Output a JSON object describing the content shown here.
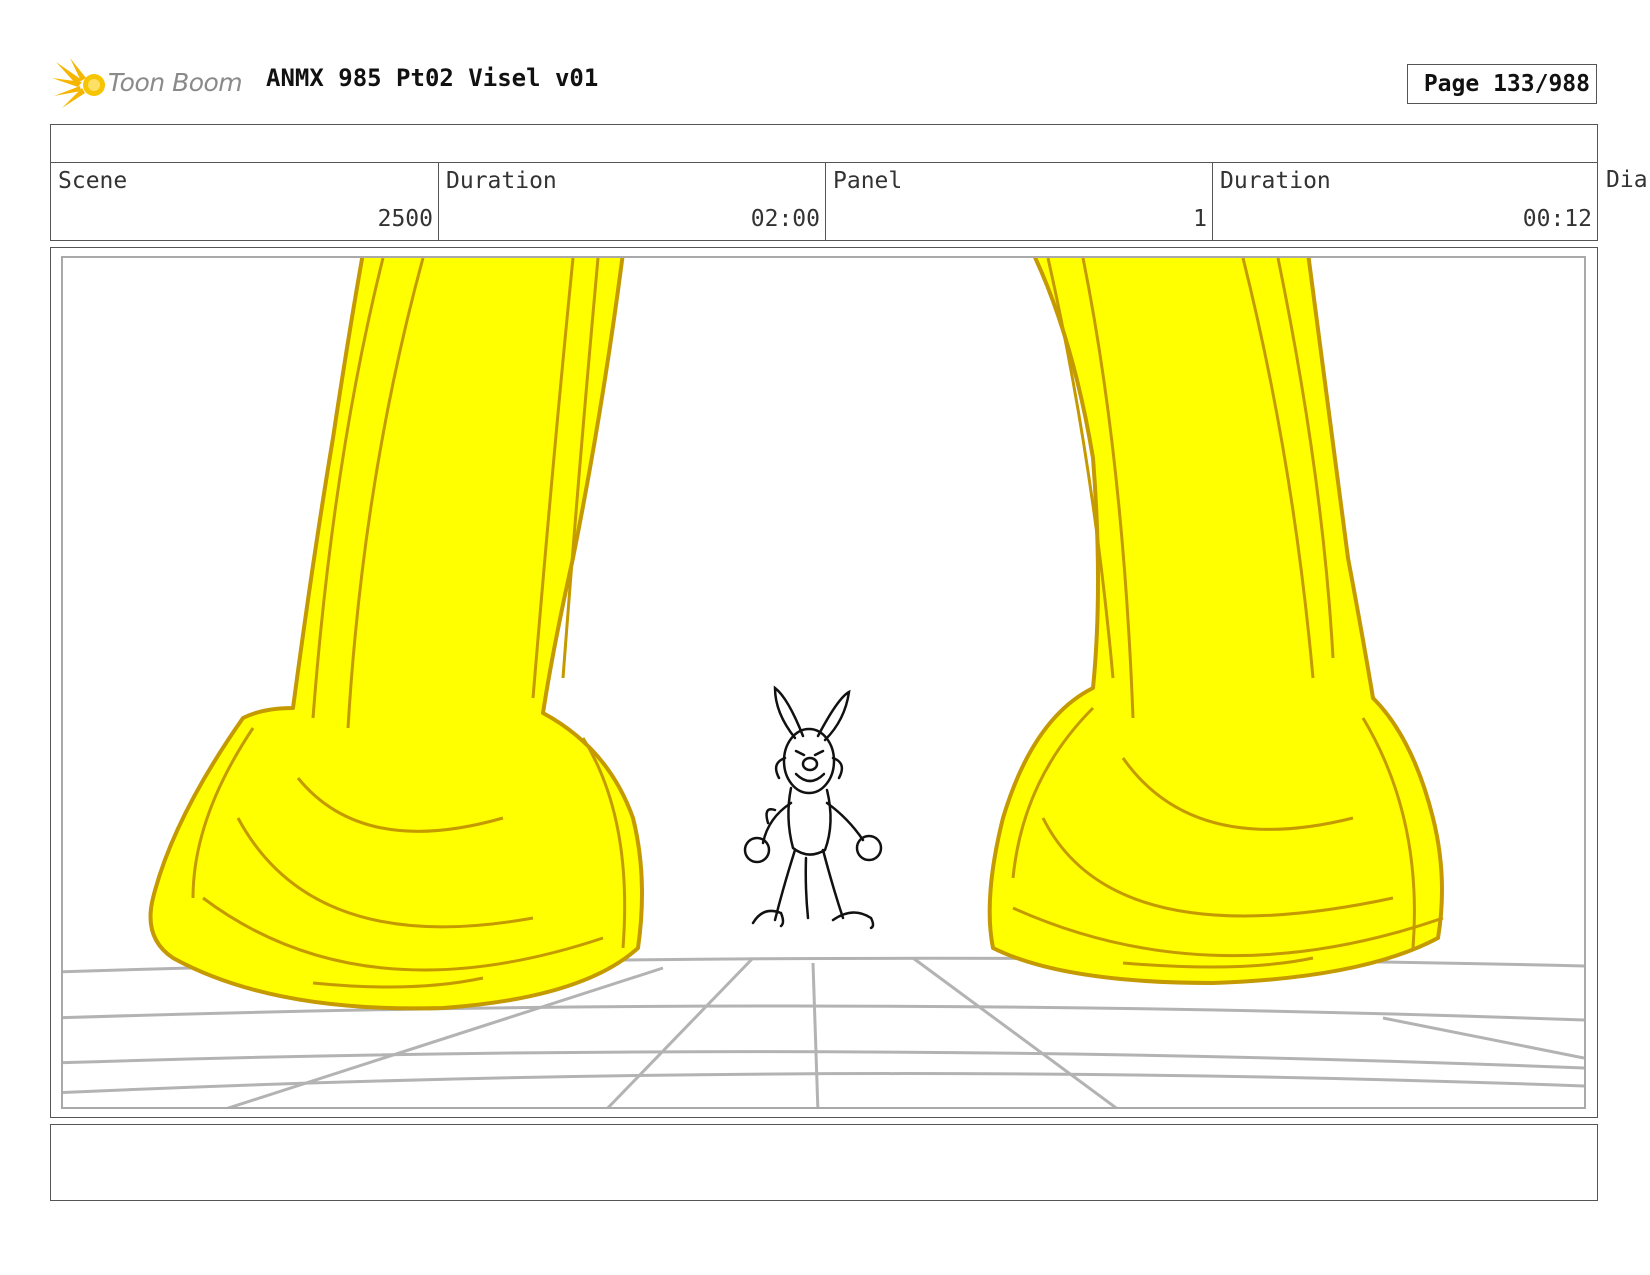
{
  "header": {
    "logo_text": "Toon Boom",
    "doc_title": "ANMX 985 Pt02 Visel v01",
    "page_label": "Page 133/988"
  },
  "info": {
    "scene_label": "Scene",
    "scene_value": "2500",
    "scene_duration_label": "Duration",
    "scene_duration_value": "02:00",
    "panel_label": "Panel",
    "panel_value": "1",
    "panel_duration_label": "Duration",
    "panel_duration_value": "00:12",
    "dialog_label_partial": "Dia"
  },
  "colors": {
    "leg_fill": "#ffff00",
    "leg_stroke": "#c49a00",
    "floor_lines": "#b3b3b3",
    "border": "#555555",
    "logo_orange": "#f5b500"
  },
  "icons": {
    "logo": "toon-boom-star-logo"
  }
}
